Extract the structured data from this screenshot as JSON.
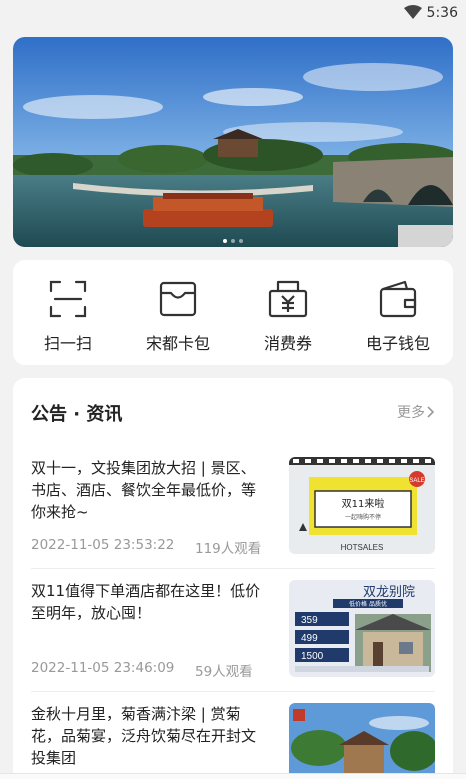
{
  "status_bar": {
    "time": "5:36",
    "wifi_icon": "wifi-icon"
  },
  "banner": {
    "image_icon": "scenic-photo-icon",
    "slides": 3,
    "active_slide": 1
  },
  "quick_actions": [
    {
      "label": "扫一扫",
      "icon": "scan-icon"
    },
    {
      "label": "宋都卡包",
      "icon": "card-wallet-icon"
    },
    {
      "label": "消费券",
      "icon": "coupon-icon"
    },
    {
      "label": "电子钱包",
      "icon": "wallet-icon"
    }
  ],
  "news": {
    "title": "公告 · 资讯",
    "more": "更多",
    "articles": [
      {
        "text": "双十一，文投集团放大招 | 景区、书店、酒店、餐饮全年最低价，等你来抢~",
        "date": "2022-11-05 23:53:22",
        "views": "119人观看"
      },
      {
        "text": "双11值得下单酒店都在这里！低价至明年，放心囤！",
        "date": "2022-11-05 23:46:09",
        "views": "59人观看"
      },
      {
        "text": "金秋十月里，菊香满汴梁 | 赏菊花，品菊宴，泛舟饮菊尽在开封文投集团",
        "date": "",
        "views": ""
      }
    ],
    "thumb1_text": {
      "main": "双11来啦",
      "sub": "一起嗨购不停",
      "footer": "HOTSALES",
      "tag": "SALE"
    },
    "thumb2_text": {
      "title": "双龙别院",
      "tags": "低价格 品质优",
      "p1": "359",
      "p2": "499",
      "p3": "1500"
    }
  }
}
